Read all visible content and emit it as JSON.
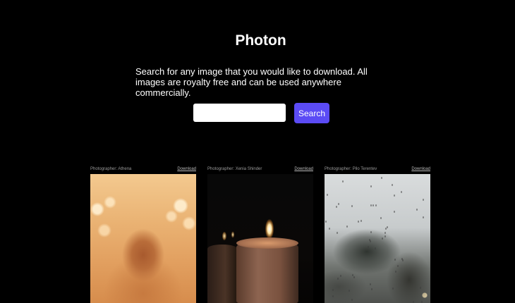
{
  "header": {
    "title": "Photon",
    "description": "Search for any image that you would like to download. All images are royalty free and can be used anywhere commercially."
  },
  "search": {
    "value": "",
    "placeholder": "",
    "button_label": "Search"
  },
  "photos": [
    {
      "photographer": "Photographer: Athena",
      "download_label": "Download"
    },
    {
      "photographer": "Photographer: Xenia Shinder",
      "download_label": "Download"
    },
    {
      "photographer": "Photographer: Pilo Terentev",
      "download_label": "Download"
    }
  ],
  "colors": {
    "background": "#000000",
    "accent": "#5b4bf5",
    "text": "#ffffff"
  }
}
